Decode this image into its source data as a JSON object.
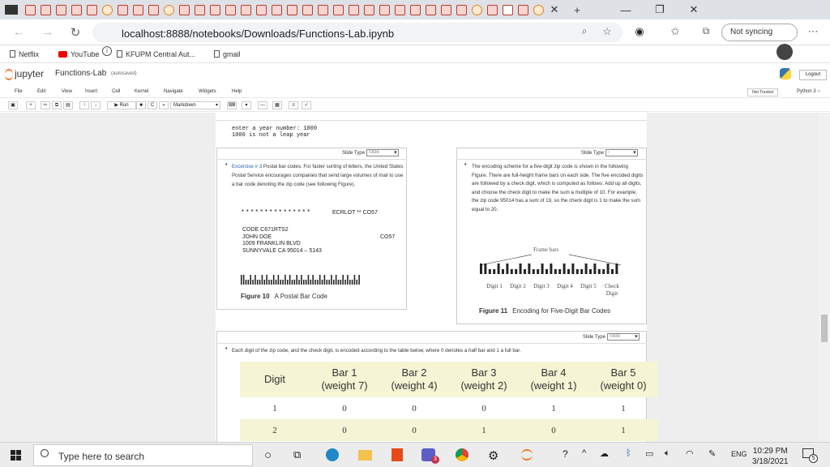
{
  "browser": {
    "url": "localhost:8888/notebooks/Downloads/Functions-Lab.ipynb",
    "sync_label": "Not syncing",
    "bookmarks": [
      "Netflix",
      "YouTube",
      "KFUPM Central Aut...",
      "gmail"
    ]
  },
  "jupyter": {
    "logo": "jupyter",
    "title": "Functions-Lab",
    "saved": "(autosaved)",
    "logout": "Logout",
    "menus": [
      "File",
      "Edit",
      "View",
      "Insert",
      "Cell",
      "Kernel",
      "Navigate",
      "Widgets",
      "Help"
    ],
    "trust": "Not Trusted",
    "kernel": "Python 3",
    "toolbar": {
      "run": "▶ Run",
      "celltype": "Markdown"
    }
  },
  "notebook": {
    "output_lines": [
      "enter a year number: 1000",
      "1000  is not a leap year"
    ],
    "slide_type_label": "Slide Type",
    "slide_options": {
      "left": "Slide",
      "right": "-",
      "bottom": "Slide"
    },
    "exercise": {
      "title": "Excercise # 3",
      "text": "Postal bar codes. For faster sorting of letters, the United States Postal Service encourages companies that send large volumes of mail to use a bar code denoting the zip code (see following Figure)."
    },
    "figure10": {
      "stars": "***************",
      "ecrlot": "ECRLOT  **  CO57",
      "line1": "CODE  C671RTS2",
      "line2": "JOHN DOE",
      "line2b": "CO57",
      "line3": "1009 FRANKLIN BLVD",
      "line4": "SUNNYVALE        CA  95014 – 5143",
      "caption_num": "Figure 10",
      "caption_text": "A Postal Bar Code"
    },
    "encoding_text": "The encoding scheme for a five-digit zip code is shown in the following Figure. There are full-height frame bars on each side. The five encoded digits are followed by a check digit, which is computed as follows: Add up all digits, and choose the check digit to make the sum a multiple of 10. For example, the zip code 95014 has a sum of 19, so the check digit is 1 to make the sum equal to 20.",
    "figure11": {
      "frame_label": "Frame bars",
      "digits": [
        "Digit 1",
        "Digit 2",
        "Digit 3",
        "Digit 4",
        "Digit 5",
        "Check Digit"
      ],
      "caption_num": "Figure 11",
      "caption_text": "Encoding for Five-Digit Bar Codes"
    },
    "table_intro": "Each digit of the zip code, and the check digit, is encoded according to the table below, where 0 denotes a half bar and 1 a full bar.",
    "table": {
      "headers": [
        "Digit",
        "Bar 1 (weight 7)",
        "Bar 2 (weight 4)",
        "Bar 3 (weight 2)",
        "Bar 4 (weight 1)",
        "Bar 5 (weight 0)"
      ],
      "rows": [
        [
          "1",
          "0",
          "0",
          "0",
          "1",
          "1"
        ],
        [
          "2",
          "0",
          "0",
          "1",
          "0",
          "1"
        ]
      ]
    }
  },
  "taskbar": {
    "search_placeholder": "Type here to search",
    "lang": "ENG",
    "time": "10:29 PM",
    "date": "3/18/2021",
    "notif_count": "5",
    "teams_badge": "3"
  }
}
